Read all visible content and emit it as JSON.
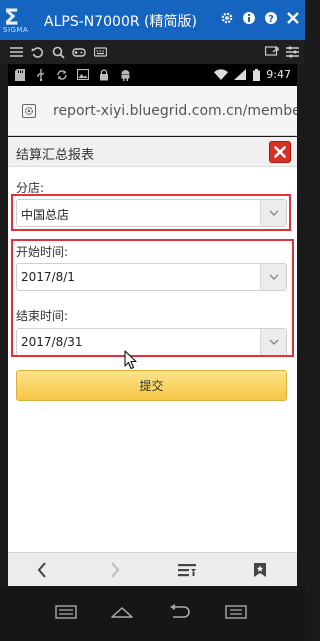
{
  "window": {
    "logo_text": "Σ",
    "logo_sub": "SIGMA",
    "title": "ALPS-N7000R (精简版)"
  },
  "status_bar": {
    "time": "9:47"
  },
  "browser": {
    "url": "report-xiyi.bluegrid.com.cn/members"
  },
  "page": {
    "title": "结算汇总报表",
    "store_label": "分店:",
    "store_value": "中国总店",
    "start_label": "开始时间:",
    "start_value": "2017/8/1",
    "end_label": "结束时间:",
    "end_value": "2017/8/31",
    "submit_label": "提交"
  },
  "colors": {
    "title_bar": "#1565c0",
    "highlight": "#e0313a",
    "submit": "#f6c743",
    "close": "#d93025"
  }
}
